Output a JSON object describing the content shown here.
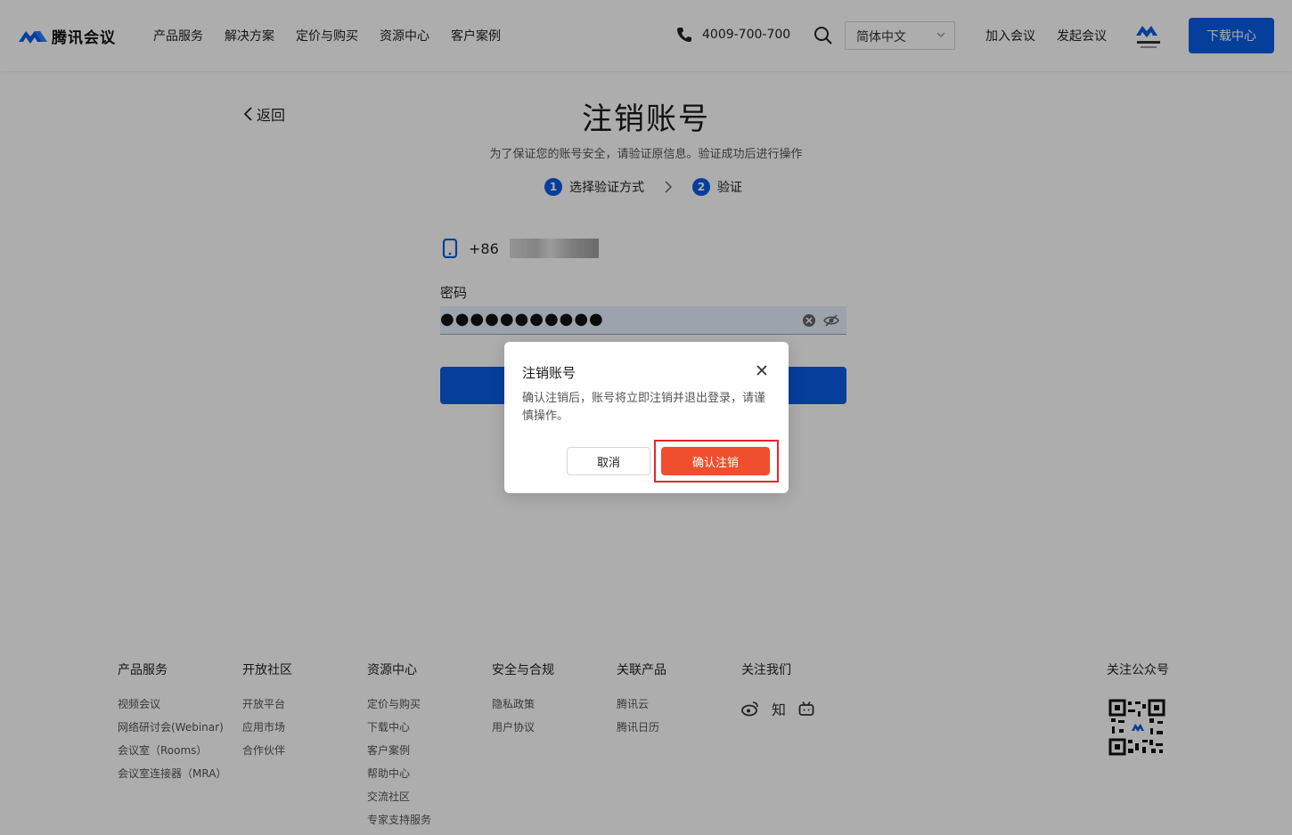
{
  "header": {
    "logo_text": "腾讯会议",
    "nav": [
      "产品服务",
      "解决方案",
      "定价与购买",
      "资源中心",
      "客户案例"
    ],
    "phone": "4009-700-700",
    "language": "简体中文",
    "join_meeting": "加入会议",
    "start_meeting": "发起会议",
    "download": "下载中心",
    "accent_color": "#0a5ce6"
  },
  "page": {
    "back": "返回",
    "title": "注销账号",
    "subtitle": "为了保证您的账号安全，请验证原信息。验证成功后进行操作",
    "steps": [
      {
        "num": "1",
        "label": "选择验证方式"
      },
      {
        "num": "2",
        "label": "验证"
      }
    ]
  },
  "form": {
    "phone_prefix": "+86",
    "password_label": "密码",
    "password_value": "●●●●●●●●●●●"
  },
  "footer": {
    "columns": [
      {
        "title": "产品服务",
        "items": [
          "视频会议",
          "网络研讨会(Webinar)",
          "会议室（Rooms）",
          "会议室连接器（MRA）"
        ]
      },
      {
        "title": "开放社区",
        "items": [
          "开放平台",
          "应用市场",
          "合作伙伴"
        ]
      },
      {
        "title": "资源中心",
        "items": [
          "定价与购买",
          "下载中心",
          "客户案例",
          "帮助中心",
          "交流社区",
          "专家支持服务"
        ]
      },
      {
        "title": "安全与合规",
        "items": [
          "隐私政策",
          "用户协议"
        ]
      },
      {
        "title": "关联产品",
        "items": [
          "腾讯云",
          "腾讯日历"
        ]
      },
      {
        "title": "关注我们",
        "items": []
      }
    ],
    "social_zhihu": "知",
    "follow_official": "关注公众号"
  },
  "dialog": {
    "title": "注销账号",
    "body": "确认注销后，账号将立即注销并退出登录，请谨慎操作。",
    "cancel": "取消",
    "confirm": "确认注销",
    "confirm_color": "#f04f2e",
    "highlight_color": "#e8262c"
  }
}
